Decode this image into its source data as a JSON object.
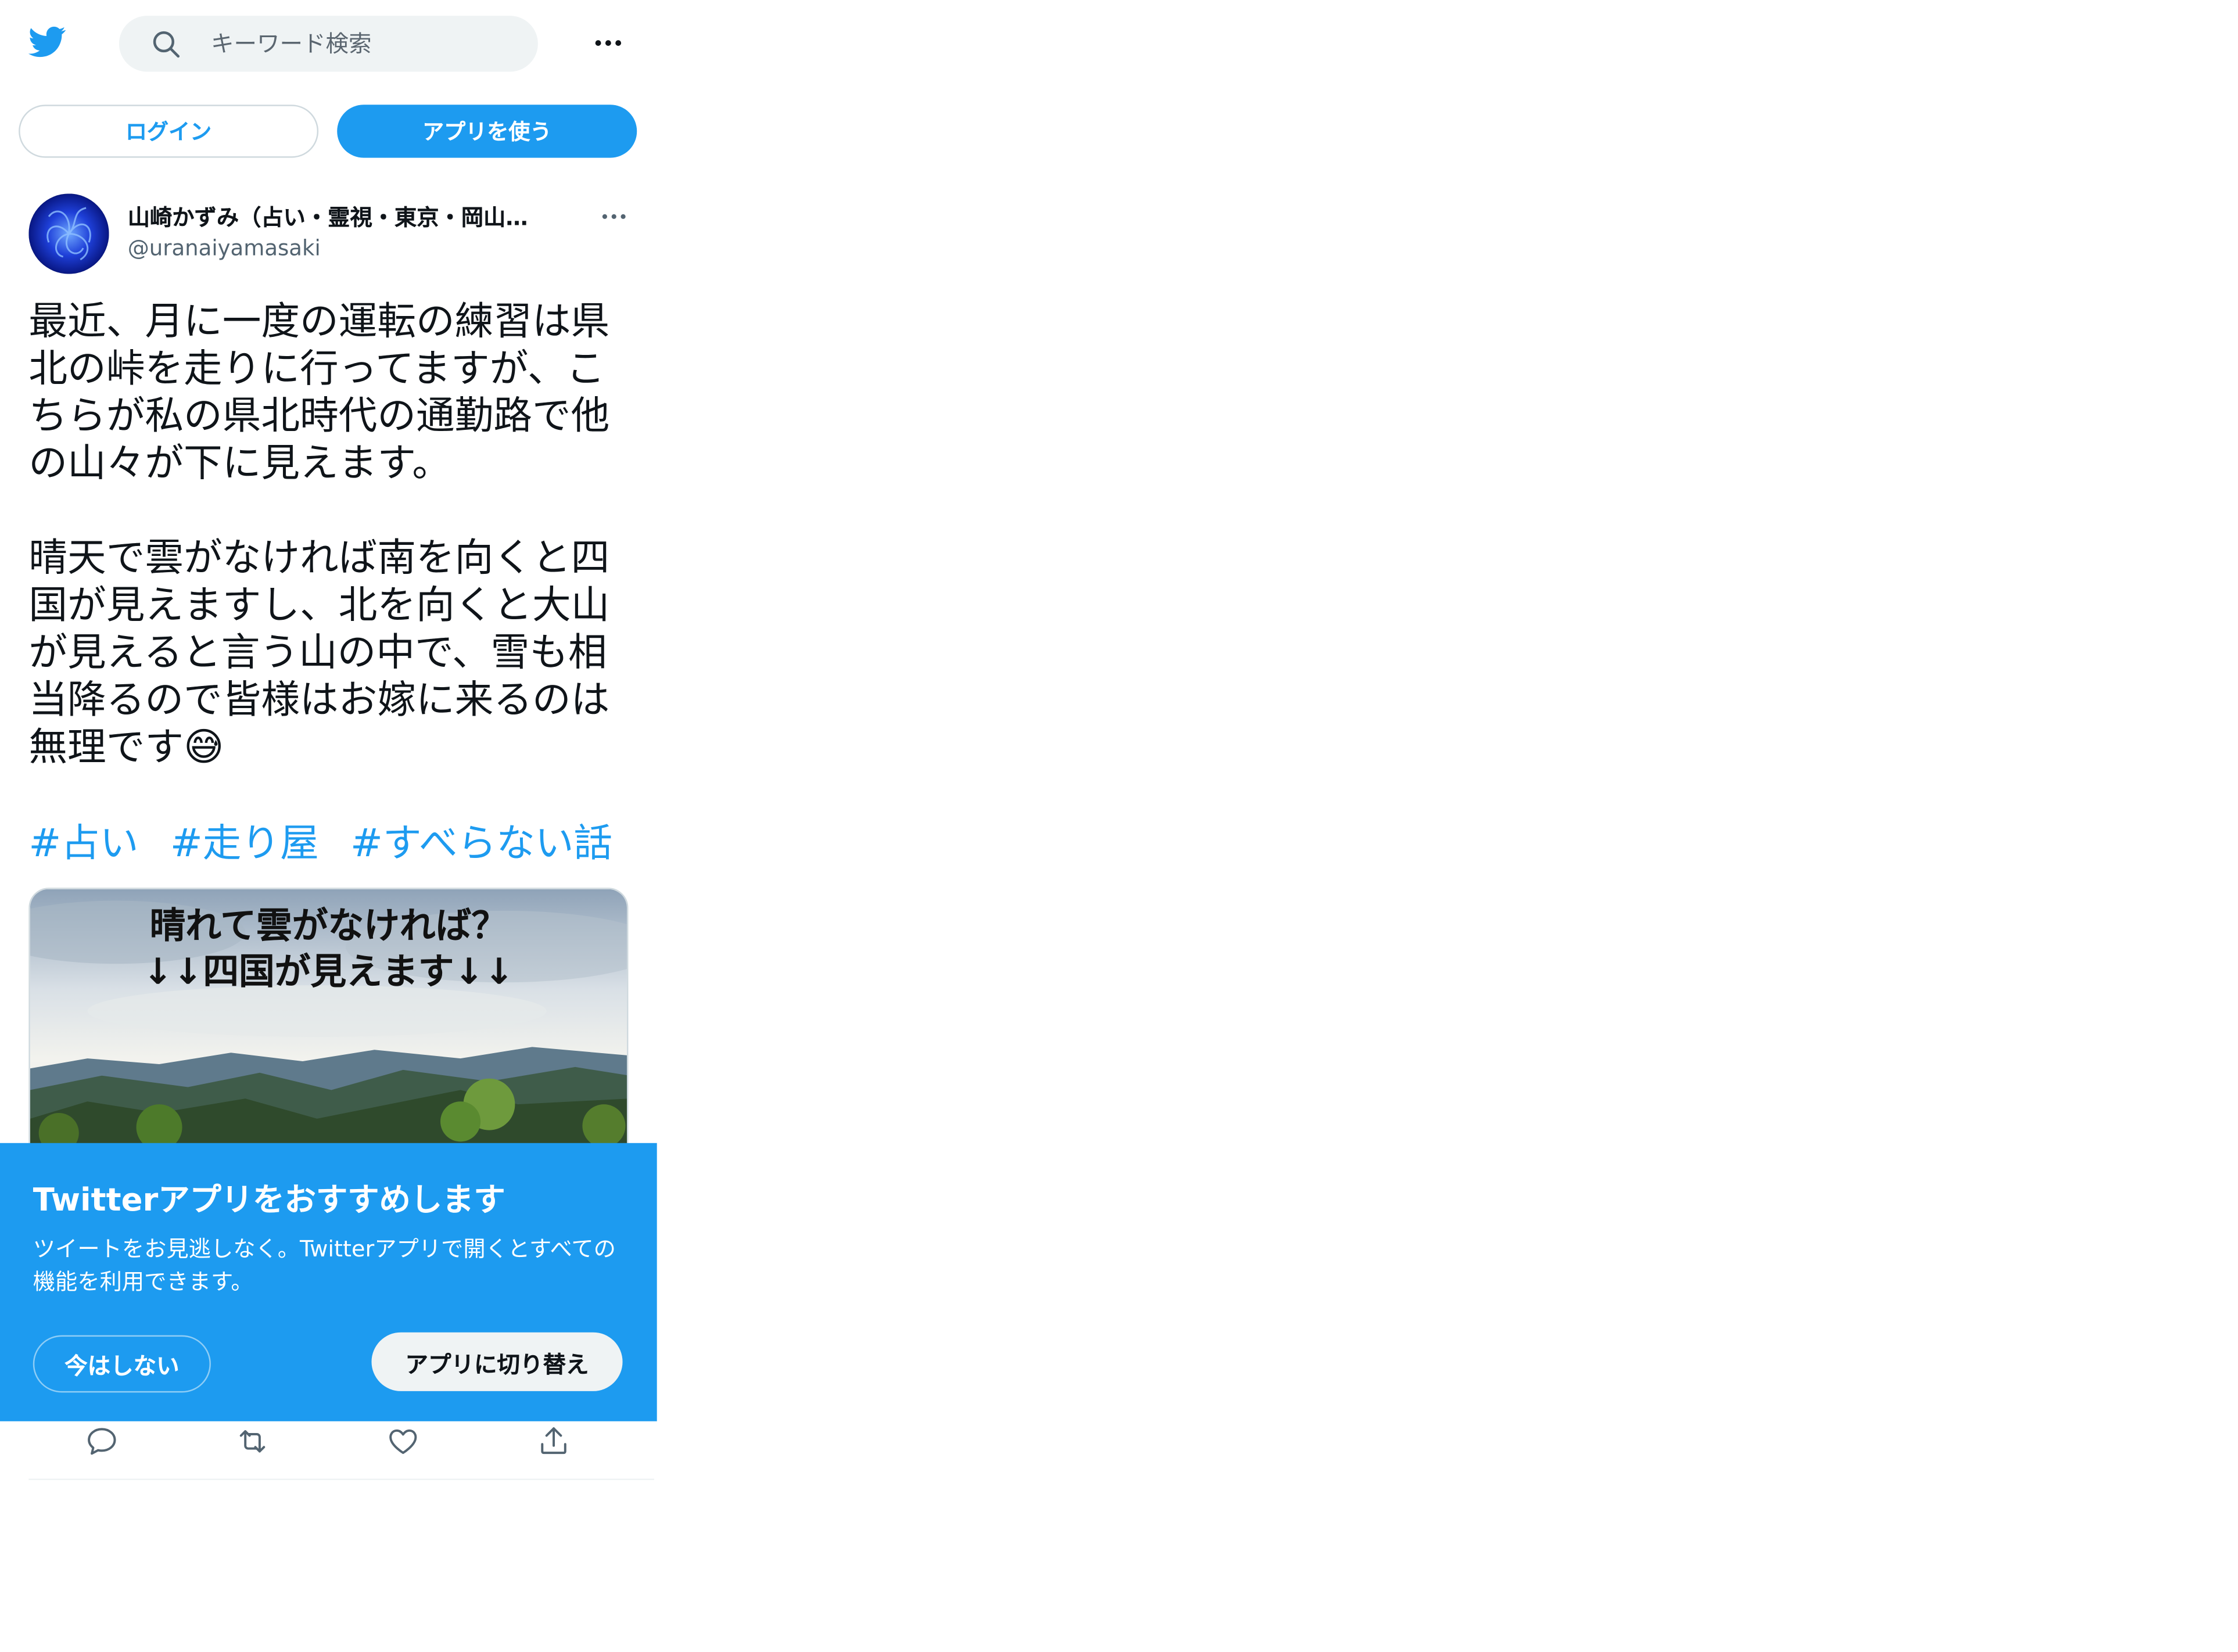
{
  "header": {
    "search_placeholder": "キーワード検索",
    "more_icon": "more-horizontal-icon",
    "logo_icon": "twitter-bird-icon"
  },
  "auth": {
    "login_label": "ログイン",
    "use_app_label": "アプリを使う"
  },
  "tweet": {
    "author_name": "山崎かずみ（占い・霊視・東京・岡山…",
    "author_handle": "@uranaiyamasaki",
    "text": "最近、月に一度の運転の練習は県北の峠を走りに行ってますが、こちらが私の県北時代の通勤路で他の山々が下に見えます。\n\n晴天で雲がなければ南を向くと四国が見えますし、北を向くと大山が見えると言う山の中で、雪も相当降るので皆様はお嫁に来るのは無理です😅",
    "hashtags": [
      "#占い",
      "#走り屋",
      "#すべらない話"
    ],
    "media_caption_line1": "晴れて雲がなければ？",
    "media_caption_line2": "↓↓四国が見えます↓↓"
  },
  "banner": {
    "title": "Twitterアプリをおすすめします",
    "description": "ツイートをお見逃しなく。Twitterアプリで開くとすべての機能を利用できます。",
    "later_label": "今はしない",
    "switch_label": "アプリに切り替え"
  },
  "actions": {
    "icons": [
      "reply-icon",
      "retweet-icon",
      "like-icon",
      "share-icon"
    ]
  },
  "colors": {
    "accent": "#1d9bf0",
    "text": "#0f1419",
    "muted": "#536471"
  }
}
